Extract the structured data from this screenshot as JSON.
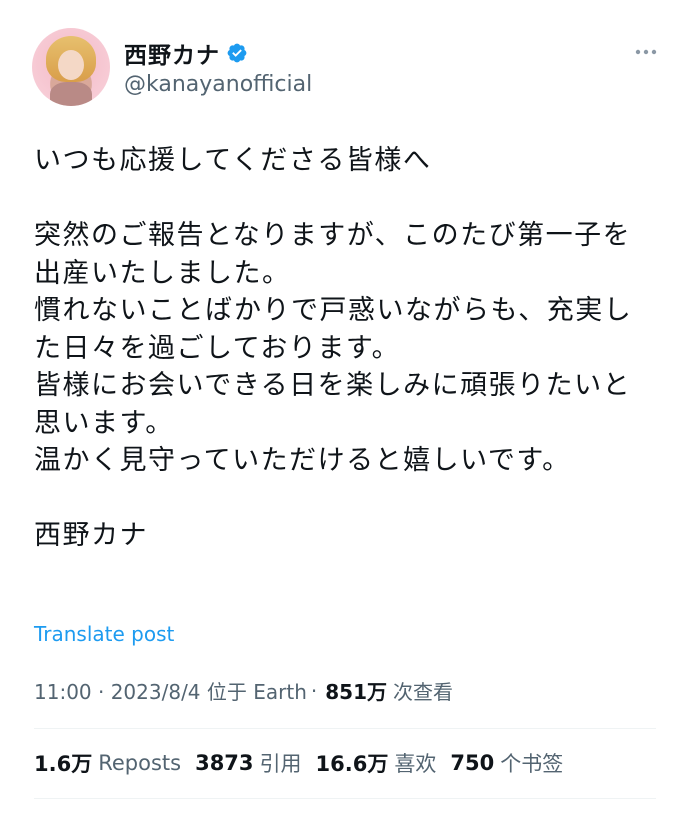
{
  "author": {
    "display_name": "西野カナ",
    "handle": "@kanayanofficial"
  },
  "icons": {
    "verified": "verified-badge-icon",
    "more": "more-options-icon"
  },
  "colors": {
    "verified_blue": "#1d9bf0",
    "link_blue": "#1d9bf0",
    "secondary_text": "#536471"
  },
  "tweet": {
    "lines": [
      "いつも応援してくださる皆様へ",
      "",
      "突然のご報告となりますが、このたび第一子を",
      "出産いたしました。",
      "慣れないことばかりで戸惑いながらも、充実し",
      "た日々を過ごしております。",
      "皆様にお会いできる日を楽しみに頑張りたいと",
      "思います。",
      "温かく見守っていただけると嬉しいです。",
      "",
      "西野カナ"
    ],
    "translate_label": "Translate post"
  },
  "meta": {
    "timestamp": "11:00 · 2023/8/4 位于 Earth",
    "separator": "·",
    "views_count": "851万",
    "views_label": "次查看"
  },
  "stats": {
    "reposts_count": "1.6万",
    "reposts_label": "Reposts",
    "quotes_count": "3873",
    "quotes_label": "引用",
    "likes_count": "16.6万",
    "likes_label": "喜欢",
    "bookmarks_count": "750",
    "bookmarks_label": "个书签"
  }
}
